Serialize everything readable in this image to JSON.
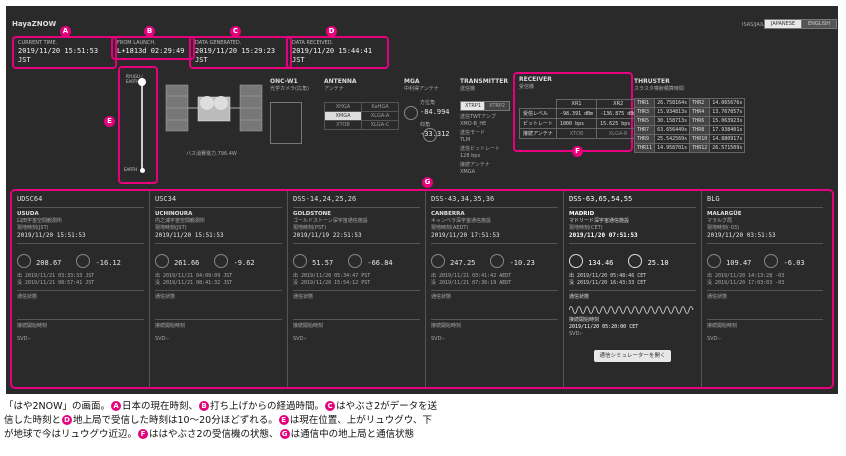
{
  "app": {
    "logo": "HayaZNOW",
    "version": "ISAS/JAXA",
    "nav": [
      "JAPANESE",
      "ENGLISH"
    ]
  },
  "markers": {
    "a": "A",
    "b": "B",
    "c": "C",
    "d": "D",
    "e": "E",
    "f": "F",
    "g": "G"
  },
  "times": {
    "current": {
      "label": "CURRENT TIME.",
      "value": "2019/11/20 15:51:53 JST"
    },
    "launch": {
      "label": "FROM LAUNCH.",
      "value": "L+1813d 02:29:49"
    },
    "generated": {
      "label": "DATA GENERATED.",
      "value": "2019/11/20 15:29:23 JST"
    },
    "received": {
      "label": "DATA RECEIVED.",
      "value": "2019/11/20 15:44:41 JST"
    }
  },
  "position": {
    "top_label": "RYUGU / EARTH",
    "bottom_label": "EARTH"
  },
  "spacecraft": {
    "power_label": "バス消費電力.796.4W"
  },
  "onc": {
    "title": "ONC-W1",
    "subtitle": "光学カメラ(広角)"
  },
  "antenna": {
    "title": "ANTENNA",
    "subtitle": "アンテナ",
    "rows": [
      [
        "XHGA",
        "KaHGA"
      ],
      [
        "XMGA",
        "XLGA-A"
      ],
      [
        "XTOB",
        "XLGA-C"
      ]
    ]
  },
  "mga": {
    "title": "MGA",
    "subtitle": "中利得アンテナ",
    "az_label": "方位角",
    "az_value": "-84.994",
    "el_label": "仰角",
    "el_value": "-33.312"
  },
  "transmitter": {
    "title": "TRANSMITTER",
    "subtitle": "送信機",
    "buttons": [
      "XTRP1",
      "XTRP2"
    ],
    "lines": [
      "送信TWTアンプ",
      "XMO-B_HE",
      "送信モード",
      "TLM",
      "送信ビットレート",
      "128 bps",
      "接続アンテナ",
      "XMGA"
    ]
  },
  "receiver": {
    "title": "RECEIVER",
    "subtitle": "受信機",
    "columns": [
      "",
      "XR1",
      "XR2"
    ],
    "rows": [
      [
        "受信レベル",
        "-98.391 dBm",
        "-136.875 dBm"
      ],
      [
        "ビットレート",
        "1000 bps",
        "15.625 bps"
      ],
      [
        "接続アンテナ",
        "XTOB",
        "XLGA-R"
      ]
    ]
  },
  "thruster": {
    "title": "THRUSTER",
    "subtitle": "スラスタ噴射積算時間",
    "rows": [
      [
        "THR1",
        "26.758164s",
        "THR2",
        "14.065676s"
      ],
      [
        "THR3",
        "15.934813s",
        "THR4",
        "13.767057s"
      ],
      [
        "THR5",
        "30.158713s",
        "THR6",
        "15.063923s"
      ],
      [
        "THR7",
        "63.656449s",
        "THR8",
        "17.938401s"
      ],
      [
        "THR9",
        "25.542569s",
        "THR10",
        "14.880917s"
      ],
      [
        "THR11",
        "14.958701s",
        "THR12",
        "26.571509s"
      ]
    ]
  },
  "stations": [
    {
      "code": "UDSC64",
      "name": "USUDA",
      "jp": "臼田宇宙空間観測所",
      "tz_label": "現地時刻(JST)",
      "time": "2019/11/20 15:51:53",
      "az": "208.67",
      "el": "-16.12",
      "times": [
        "出 2019/11/21 03:33:33 JST",
        "没 2019/11/21 08:57:41 JST"
      ],
      "status": "通信状態",
      "link_label": "接続開始時刻",
      "link_value": "SVD:-"
    },
    {
      "code": "USC34",
      "name": "UCHINOURA",
      "jp": "内之浦宇宙空間観測所",
      "tz_label": "現地時刻(JST)",
      "time": "2019/11/20 15:51:53",
      "az": "261.66",
      "el": "-9.62",
      "times": [
        "出 2019/11/21 04:09:09 JST",
        "没 2019/11/21 08:41:32 JST"
      ],
      "status": "通信状態",
      "link_label": "接続開始時刻",
      "link_value": "SVD:-"
    },
    {
      "code": "DSS-14,24,25,26",
      "name": "GOLDSTONE",
      "jp": "ゴールドストーン深宇宙通信施設",
      "tz_label": "現地時刻(PST)",
      "time": "2019/11/19 22:51:53",
      "az": "51.57",
      "el": "-66.84",
      "times": [
        "出 2019/11/20 05:34:47 PST",
        "没 2019/11/20 15:54:12 PST"
      ],
      "status": "通信状態",
      "link_label": "接続開始時刻",
      "link_value": "SVD:-"
    },
    {
      "code": "DSS-43,34,35,36",
      "name": "CANBERRA",
      "jp": "キャンベラ深宇宙通信施設",
      "tz_label": "現地時刻(AEDT)",
      "time": "2019/11/20 17:51:53",
      "az": "247.25",
      "el": "-10.23",
      "times": [
        "出 2019/11/21 03:41:42 AEDT",
        "没 2019/11/21 07:30:19 AEDT"
      ],
      "status": "通信状態",
      "link_label": "接続開始時刻",
      "link_value": "SVD:-"
    },
    {
      "code": "DSS-63,65,54,55",
      "name": "MADRID",
      "jp": "マドリード深宇宙通信施設",
      "tz_label": "現地時刻(CET)",
      "time": "2019/11/20 07:51:53",
      "az": "134.46",
      "el": "25.10",
      "times": [
        "出 2019/11/20 05:48:46 CET",
        "没 2019/11/20 16:43:33 CET"
      ],
      "status": "通信状態",
      "link_label": "接続開始時刻",
      "link_value": "2019/11/20 05:20:00 CET",
      "svd": "SVD:-",
      "button": "通信シミュレーターを開く"
    },
    {
      "code": "BLG",
      "name": "MALARGÜE",
      "jp": "マラルグ局",
      "tz_label": "現地時刻(-03)",
      "time": "2019/11/20 03:51:53",
      "az": "109.47",
      "el": "-6.03",
      "times": [
        "出 2019/11/20 14:13:28 -03",
        "没 2019/11/20 17:03:03 -03"
      ],
      "status": "通信状態",
      "link_label": "接続開始時刻",
      "link_value": "SVD:-"
    }
  ],
  "caption": {
    "l1a": "「はや2NOW」の画面。",
    "l1b": "日本の現在時刻、",
    "l1c": "打ち上げからの経過時間。",
    "l1d": "はやぶさ2がデータを送",
    "l2a": "信した時刻と",
    "l2b": "地上局で受信した時刻は10〜20分ほどずれる。",
    "l2c": "は現在位置、上がリュウグウ、下",
    "l3a": "が地球で今はリュウグウ近辺。",
    "l3b": "ははやぶさ2の受信機の状態、",
    "l3c": "は通信中の地上局と通信状態"
  }
}
